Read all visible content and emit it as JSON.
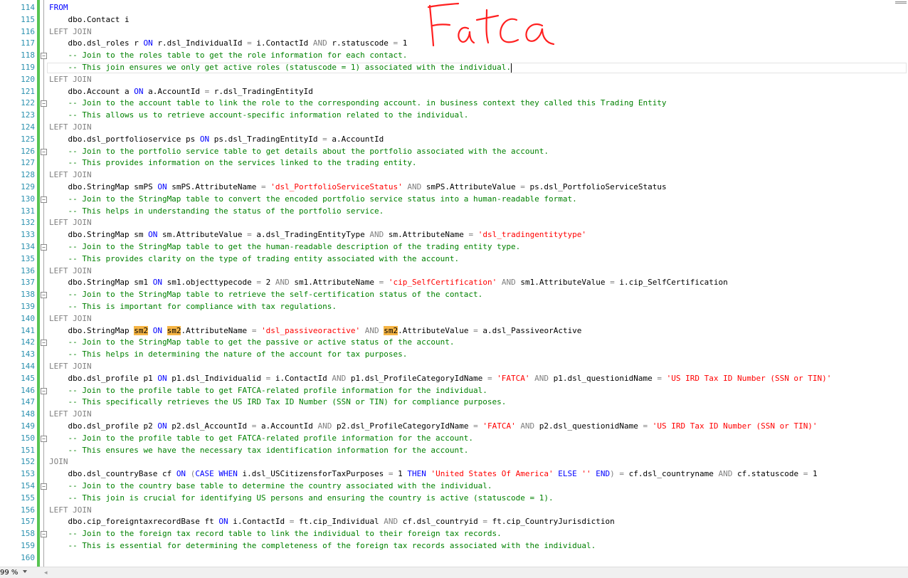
{
  "status": {
    "zoom": "99 %"
  },
  "annotation": {
    "text": "Fatca",
    "color": "#ff2020"
  },
  "colors": {
    "keyword": "#0000ff",
    "operator": "#808080",
    "string": "#ff0000",
    "comment": "#008000",
    "line_number": "#2b91af",
    "change_bar": "#57c453",
    "highlight": "#f6b545"
  },
  "lines": [
    {
      "n": "114",
      "fold": false,
      "tokens": [
        [
          "kw",
          "FROM"
        ]
      ]
    },
    {
      "n": "115",
      "fold": false,
      "tokens": [
        [
          "tx",
          "    dbo.Contact i"
        ]
      ]
    },
    {
      "n": "116",
      "fold": false,
      "tokens": [
        [
          "gr",
          "LEFT JOIN"
        ]
      ]
    },
    {
      "n": "117",
      "fold": false,
      "tokens": [
        [
          "tx",
          "    dbo.dsl_roles r "
        ],
        [
          "kw",
          "ON"
        ],
        [
          "tx",
          " r.dsl_IndividualId "
        ],
        [
          "gr",
          "="
        ],
        [
          "tx",
          " i.ContactId "
        ],
        [
          "gr",
          "AND"
        ],
        [
          "tx",
          " r.statuscode "
        ],
        [
          "gr",
          "="
        ],
        [
          "tx",
          " 1"
        ]
      ]
    },
    {
      "n": "118",
      "fold": true,
      "tokens": [
        [
          "cm",
          "    -- Join to the roles table to get the role information for each contact."
        ]
      ]
    },
    {
      "n": "119",
      "fold": false,
      "current": true,
      "tokens": [
        [
          "cm",
          "    -- This join ensures we only get active roles (statuscode = 1) associated with the individual."
        ],
        [
          "caret",
          ""
        ]
      ]
    },
    {
      "n": "120",
      "fold": false,
      "tokens": [
        [
          "gr",
          "LEFT JOIN"
        ]
      ]
    },
    {
      "n": "121",
      "fold": false,
      "tokens": [
        [
          "tx",
          "    dbo.Account a "
        ],
        [
          "kw",
          "ON"
        ],
        [
          "tx",
          " a.AccountId "
        ],
        [
          "gr",
          "="
        ],
        [
          "tx",
          " r.dsl_TradingEntityId"
        ]
      ]
    },
    {
      "n": "122",
      "fold": true,
      "tokens": [
        [
          "cm",
          "    -- Join to the account table to link the role to the corresponding account. in business context they called this Trading Entity"
        ]
      ]
    },
    {
      "n": "123",
      "fold": false,
      "tokens": [
        [
          "cm",
          "    -- This allows us to retrieve account-specific information related to the individual."
        ]
      ]
    },
    {
      "n": "124",
      "fold": false,
      "tokens": [
        [
          "gr",
          "LEFT JOIN"
        ]
      ]
    },
    {
      "n": "125",
      "fold": false,
      "tokens": [
        [
          "tx",
          "    dbo.dsl_portfolioservice ps "
        ],
        [
          "kw",
          "ON"
        ],
        [
          "tx",
          " ps.dsl_TradingEntityId "
        ],
        [
          "gr",
          "="
        ],
        [
          "tx",
          " a.AccountId"
        ]
      ]
    },
    {
      "n": "126",
      "fold": true,
      "tokens": [
        [
          "cm",
          "    -- Join to the portfolio service table to get details about the portfolio associated with the account."
        ]
      ]
    },
    {
      "n": "127",
      "fold": false,
      "tokens": [
        [
          "cm",
          "    -- This provides information on the services linked to the trading entity."
        ]
      ]
    },
    {
      "n": "128",
      "fold": false,
      "tokens": [
        [
          "gr",
          "LEFT JOIN"
        ]
      ]
    },
    {
      "n": "129",
      "fold": false,
      "tokens": [
        [
          "tx",
          "    dbo.StringMap smPS "
        ],
        [
          "kw",
          "ON"
        ],
        [
          "tx",
          " smPS.AttributeName "
        ],
        [
          "gr",
          "="
        ],
        [
          "tx",
          " "
        ],
        [
          "str",
          "'dsl_PortfolioServiceStatus'"
        ],
        [
          "tx",
          " "
        ],
        [
          "gr",
          "AND"
        ],
        [
          "tx",
          " smPS.AttributeValue "
        ],
        [
          "gr",
          "="
        ],
        [
          "tx",
          " ps.dsl_PortfolioServiceStatus"
        ]
      ]
    },
    {
      "n": "130",
      "fold": true,
      "tokens": [
        [
          "cm",
          "    -- Join to the StringMap table to convert the encoded portfolio service status into a human-readable format."
        ]
      ]
    },
    {
      "n": "131",
      "fold": false,
      "tokens": [
        [
          "cm",
          "    -- This helps in understanding the status of the portfolio service."
        ]
      ]
    },
    {
      "n": "132",
      "fold": false,
      "tokens": [
        [
          "gr",
          "LEFT JOIN"
        ]
      ]
    },
    {
      "n": "133",
      "fold": false,
      "tokens": [
        [
          "tx",
          "    dbo.StringMap sm "
        ],
        [
          "kw",
          "ON"
        ],
        [
          "tx",
          " sm.AttributeValue "
        ],
        [
          "gr",
          "="
        ],
        [
          "tx",
          " a.dsl_TradingEntityType "
        ],
        [
          "gr",
          "AND"
        ],
        [
          "tx",
          " sm.AttributeName "
        ],
        [
          "gr",
          "="
        ],
        [
          "tx",
          " "
        ],
        [
          "str",
          "'dsl_tradingentitytype'"
        ]
      ]
    },
    {
      "n": "134",
      "fold": true,
      "tokens": [
        [
          "cm",
          "    -- Join to the StringMap table to get the human-readable description of the trading entity type."
        ]
      ]
    },
    {
      "n": "135",
      "fold": false,
      "tokens": [
        [
          "cm",
          "    -- This provides clarity on the type of trading entity associated with the account."
        ]
      ]
    },
    {
      "n": "136",
      "fold": false,
      "tokens": [
        [
          "gr",
          "LEFT JOIN"
        ]
      ]
    },
    {
      "n": "137",
      "fold": false,
      "tokens": [
        [
          "tx",
          "    dbo.StringMap sm1 "
        ],
        [
          "kw",
          "ON"
        ],
        [
          "tx",
          " sm1.objecttypecode "
        ],
        [
          "gr",
          "="
        ],
        [
          "tx",
          " 2 "
        ],
        [
          "gr",
          "AND"
        ],
        [
          "tx",
          " sm1.AttributeName "
        ],
        [
          "gr",
          "="
        ],
        [
          "tx",
          " "
        ],
        [
          "str",
          "'cip_SelfCertification'"
        ],
        [
          "tx",
          " "
        ],
        [
          "gr",
          "AND"
        ],
        [
          "tx",
          " sm1.AttributeValue "
        ],
        [
          "gr",
          "="
        ],
        [
          "tx",
          " i.cip_SelfCertification"
        ]
      ]
    },
    {
      "n": "138",
      "fold": true,
      "tokens": [
        [
          "cm",
          "    -- Join to the StringMap table to retrieve the self-certification status of the contact."
        ]
      ]
    },
    {
      "n": "139",
      "fold": false,
      "tokens": [
        [
          "cm",
          "    -- This is important for compliance with tax regulations."
        ]
      ]
    },
    {
      "n": "140",
      "fold": false,
      "tokens": [
        [
          "gr",
          "LEFT JOIN"
        ]
      ]
    },
    {
      "n": "141",
      "fold": false,
      "tokens": [
        [
          "tx",
          "    dbo.StringMap "
        ],
        [
          "hl",
          "sm2"
        ],
        [
          "tx",
          " "
        ],
        [
          "kw",
          "ON"
        ],
        [
          "tx",
          " "
        ],
        [
          "hl",
          "sm2"
        ],
        [
          "tx",
          ".AttributeName "
        ],
        [
          "gr",
          "="
        ],
        [
          "tx",
          " "
        ],
        [
          "str",
          "'dsl_passiveoractive'"
        ],
        [
          "tx",
          " "
        ],
        [
          "gr",
          "AND"
        ],
        [
          "tx",
          " "
        ],
        [
          "hl",
          "sm2"
        ],
        [
          "tx",
          ".AttributeValue "
        ],
        [
          "gr",
          "="
        ],
        [
          "tx",
          " a.dsl_PassiveorActive"
        ]
      ]
    },
    {
      "n": "142",
      "fold": true,
      "tokens": [
        [
          "cm",
          "    -- Join to the StringMap table to get the passive or active status of the account."
        ]
      ]
    },
    {
      "n": "143",
      "fold": false,
      "tokens": [
        [
          "cm",
          "    -- This helps in determining the nature of the account for tax purposes."
        ]
      ]
    },
    {
      "n": "144",
      "fold": false,
      "tokens": [
        [
          "gr",
          "LEFT JOIN"
        ]
      ]
    },
    {
      "n": "145",
      "fold": false,
      "tokens": [
        [
          "tx",
          "    dbo.dsl_profile p1 "
        ],
        [
          "kw",
          "ON"
        ],
        [
          "tx",
          " p1.dsl_Individualid "
        ],
        [
          "gr",
          "="
        ],
        [
          "tx",
          " i.ContactId "
        ],
        [
          "gr",
          "AND"
        ],
        [
          "tx",
          " p1.dsl_ProfileCategoryIdName "
        ],
        [
          "gr",
          "="
        ],
        [
          "tx",
          " "
        ],
        [
          "str",
          "'FATCA'"
        ],
        [
          "tx",
          " "
        ],
        [
          "gr",
          "AND"
        ],
        [
          "tx",
          " p1.dsl_questionidName "
        ],
        [
          "gr",
          "="
        ],
        [
          "tx",
          " "
        ],
        [
          "str",
          "'US IRD Tax ID Number (SSN or TIN)'"
        ]
      ]
    },
    {
      "n": "146",
      "fold": true,
      "tokens": [
        [
          "cm",
          "    -- Join to the profile table to get FATCA-related profile information for the individual."
        ]
      ]
    },
    {
      "n": "147",
      "fold": false,
      "tokens": [
        [
          "cm",
          "    -- This specifically retrieves the US IRD Tax ID Number (SSN or TIN) for compliance purposes."
        ]
      ]
    },
    {
      "n": "148",
      "fold": false,
      "tokens": [
        [
          "gr",
          "LEFT JOIN"
        ]
      ]
    },
    {
      "n": "149",
      "fold": false,
      "tokens": [
        [
          "tx",
          "    dbo.dsl_profile p2 "
        ],
        [
          "kw",
          "ON"
        ],
        [
          "tx",
          " p2.dsl_AccountId "
        ],
        [
          "gr",
          "="
        ],
        [
          "tx",
          " a.AccountId "
        ],
        [
          "gr",
          "AND"
        ],
        [
          "tx",
          " p2.dsl_ProfileCategoryIdName "
        ],
        [
          "gr",
          "="
        ],
        [
          "tx",
          " "
        ],
        [
          "str",
          "'FATCA'"
        ],
        [
          "tx",
          " "
        ],
        [
          "gr",
          "AND"
        ],
        [
          "tx",
          " p2.dsl_questionidName "
        ],
        [
          "gr",
          "="
        ],
        [
          "tx",
          " "
        ],
        [
          "str",
          "'US IRD Tax ID Number (SSN or TIN)'"
        ]
      ]
    },
    {
      "n": "150",
      "fold": true,
      "tokens": [
        [
          "cm",
          "    -- Join to the profile table to get FATCA-related profile information for the account."
        ]
      ]
    },
    {
      "n": "151",
      "fold": false,
      "tokens": [
        [
          "cm",
          "    -- This ensures we have the necessary tax identification information for the account."
        ]
      ]
    },
    {
      "n": "152",
      "fold": false,
      "tokens": [
        [
          "gr",
          "JOIN"
        ]
      ]
    },
    {
      "n": "153",
      "fold": false,
      "tokens": [
        [
          "tx",
          "    dbo.dsl_countryBase cf "
        ],
        [
          "kw",
          "ON"
        ],
        [
          "tx",
          " "
        ],
        [
          "gr",
          "("
        ],
        [
          "kw",
          "CASE WHEN"
        ],
        [
          "tx",
          " i.dsl_USCitizensforTaxPurposes "
        ],
        [
          "gr",
          "="
        ],
        [
          "tx",
          " 1 "
        ],
        [
          "kw",
          "THEN"
        ],
        [
          "tx",
          " "
        ],
        [
          "str",
          "'United States Of America'"
        ],
        [
          "tx",
          " "
        ],
        [
          "kw",
          "ELSE"
        ],
        [
          "tx",
          " "
        ],
        [
          "str",
          "''"
        ],
        [
          "tx",
          " "
        ],
        [
          "kw",
          "END"
        ],
        [
          "gr",
          ")"
        ],
        [
          "tx",
          " "
        ],
        [
          "gr",
          "="
        ],
        [
          "tx",
          " cf.dsl_countryname "
        ],
        [
          "gr",
          "AND"
        ],
        [
          "tx",
          " cf.statuscode "
        ],
        [
          "gr",
          "="
        ],
        [
          "tx",
          " 1"
        ]
      ]
    },
    {
      "n": "154",
      "fold": true,
      "tokens": [
        [
          "cm",
          "    -- Join to the country base table to determine the country associated with the individual."
        ]
      ]
    },
    {
      "n": "155",
      "fold": false,
      "tokens": [
        [
          "cm",
          "    -- This join is crucial for identifying US persons and ensuring the country is active (statuscode = 1)."
        ]
      ]
    },
    {
      "n": "156",
      "fold": false,
      "tokens": [
        [
          "gr",
          "LEFT JOIN"
        ]
      ]
    },
    {
      "n": "157",
      "fold": false,
      "tokens": [
        [
          "tx",
          "    dbo.cip_foreigntaxrecordBase ft "
        ],
        [
          "kw",
          "ON"
        ],
        [
          "tx",
          " i.ContactId "
        ],
        [
          "gr",
          "="
        ],
        [
          "tx",
          " ft.cip_Individual "
        ],
        [
          "gr",
          "AND"
        ],
        [
          "tx",
          " cf.dsl_countryid "
        ],
        [
          "gr",
          "="
        ],
        [
          "tx",
          " ft.cip_CountryJurisdiction"
        ]
      ]
    },
    {
      "n": "158",
      "fold": true,
      "tokens": [
        [
          "cm",
          "    -- Join to the foreign tax record table to link the individual to their foreign tax records."
        ]
      ]
    },
    {
      "n": "159",
      "fold": false,
      "tokens": [
        [
          "cm",
          "    -- This is essential for determining the completeness of the foreign tax records associated with the individual."
        ]
      ]
    },
    {
      "n": "160",
      "fold": false,
      "tokens": []
    }
  ]
}
